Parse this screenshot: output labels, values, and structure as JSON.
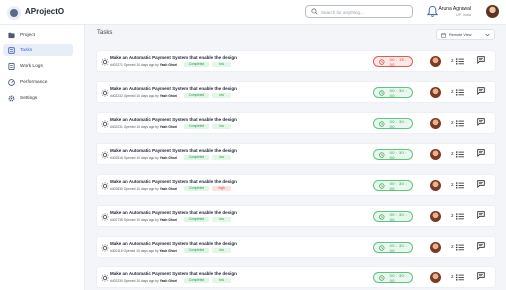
{
  "header": {
    "app_name": "AProjectO",
    "search_placeholder": "Search for anything...",
    "user_name": "Aruna Agrawal",
    "user_location": "UP, India"
  },
  "sidebar": {
    "items": [
      {
        "label": "Project",
        "icon": "folder-icon",
        "active": false
      },
      {
        "label": "Tasks",
        "icon": "tasks-icon",
        "active": true
      },
      {
        "label": "Work Logs",
        "icon": "worklogs-icon",
        "active": false
      },
      {
        "label": "Performance",
        "icon": "performance-icon",
        "active": false
      },
      {
        "label": "Settings",
        "icon": "settings-icon",
        "active": false
      }
    ]
  },
  "main": {
    "title": "Tasks",
    "filter_label": "Remote View"
  },
  "colors": {
    "accent": "#3a6fd8",
    "completed_green": "#29974c",
    "timer_red": "#d23a2e",
    "timer_green": "#2d9a53",
    "priority_low_bg": "#e3f7e7",
    "priority_high_bg": "#fde2e4"
  },
  "tasks": [
    {
      "title": "Make an Automatic Payment System that enable the design",
      "id": "#402271",
      "opened": "Opened 10 days ago by",
      "author": "Yash Ghori",
      "status": "Completed",
      "priority": "low",
      "timer": "00 : 15 : 00",
      "timer_state": "running",
      "subtasks": "2"
    },
    {
      "title": "Make an Automatic Payment System that enable the design",
      "id": "#402232",
      "opened": "Opened 10 days ago by",
      "author": "Yash Ghori",
      "status": "Completed",
      "priority": "low",
      "timer": "00 : 30 : 00",
      "timer_state": "stopped",
      "subtasks": "2"
    },
    {
      "title": "Make an Automatic Payment System that enable the design",
      "id": "#402231",
      "opened": "Opened 10 days ago by",
      "author": "Yash Ghori",
      "status": "Completed",
      "priority": "low",
      "timer": "00 : 30 : 00",
      "timer_state": "stopped",
      "subtasks": "2"
    },
    {
      "title": "Make an Automatic Payment System that enable the design",
      "id": "#402516",
      "opened": "Opened 10 days ago by",
      "author": "Yash Ghori",
      "status": "Completed",
      "priority": "low",
      "timer": "00 : 30 : 00",
      "timer_state": "stopped",
      "subtasks": "2"
    },
    {
      "title": "Make an Automatic Payment System that enable the design",
      "id": "#402830",
      "opened": "Opened 10 days ago by",
      "author": "Yash Ghori",
      "status": "Completed",
      "priority": "high",
      "timer": "00 : 30 : 00",
      "timer_state": "stopped",
      "subtasks": "2"
    },
    {
      "title": "Make an Automatic Payment System that enable the design",
      "id": "#402735",
      "opened": "Opened 10 days ago by",
      "author": "Yash Ghori",
      "status": "Completed",
      "priority": "low",
      "timer": "00 : 30 : 00",
      "timer_state": "stopped",
      "subtasks": "2"
    },
    {
      "title": "Make an Automatic Payment System that enable the design",
      "id": "#402115",
      "opened": "Opened 10 days ago by",
      "author": "Yash Ghori",
      "status": "Completed",
      "priority": "low",
      "timer": "00 : 30 : 00",
      "timer_state": "stopped",
      "subtasks": "2"
    },
    {
      "title": "Make an Automatic Payment System that enable the design",
      "id": "#402230",
      "opened": "Opened 10 days ago by",
      "author": "Yash Ghori",
      "status": "Completed",
      "priority": "low",
      "timer": "00 : 30 : 00",
      "timer_state": "stopped",
      "subtasks": "2"
    }
  ]
}
